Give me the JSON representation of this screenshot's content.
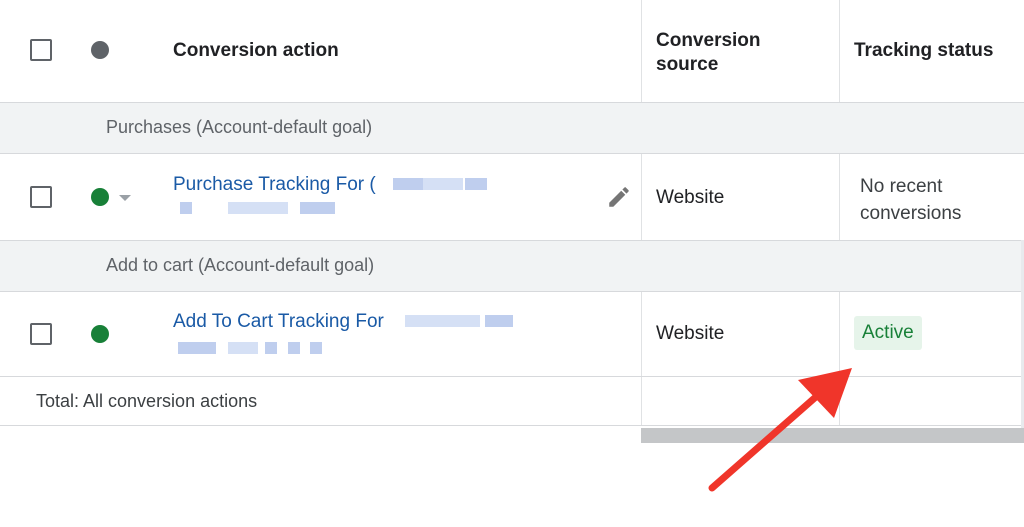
{
  "header": {
    "conversion_action": "Conversion action",
    "conversion_source_line1": "Conversion",
    "conversion_source_line2": "source",
    "tracking_status": "Tracking status"
  },
  "groups": [
    {
      "label": "Purchases (Account-default goal)"
    },
    {
      "label": "Add to cart (Account-default goal)"
    }
  ],
  "rows": [
    {
      "action": "Purchase Tracking For (",
      "status_dot_color": "#188038",
      "source": "Website",
      "tracking_line1": "No recent",
      "tracking_line2": "conversions"
    },
    {
      "action": "Add To Cart Tracking For",
      "status_dot_color": "#188038",
      "source": "Website",
      "tracking_status": "Active"
    }
  ],
  "total": {
    "label": "Total: All conversion actions"
  },
  "icons": {
    "header_status": "status-dot-icon",
    "edit": "pencil-icon",
    "dropdown": "caret-down-icon"
  },
  "annotation": {
    "arrow_color": "#f0352a"
  }
}
